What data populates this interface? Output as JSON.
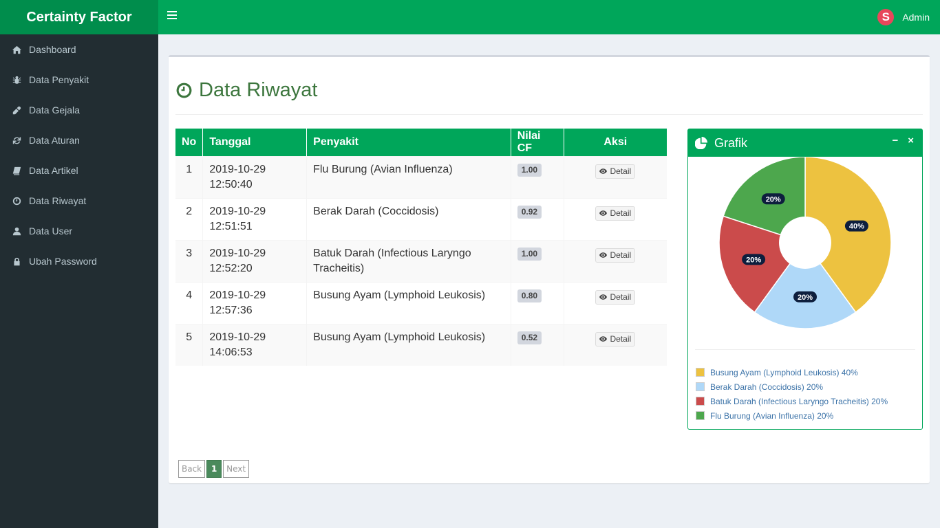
{
  "app": {
    "title": "Certainty Factor"
  },
  "header": {
    "user_name": "Admin",
    "avatar_letter": "S",
    "avatar_color": "#e8475b"
  },
  "sidebar": {
    "items": [
      {
        "label": "Dashboard",
        "icon": "home-icon"
      },
      {
        "label": "Data Penyakit",
        "icon": "bug-icon"
      },
      {
        "label": "Data Gejala",
        "icon": "eyedropper-icon"
      },
      {
        "label": "Data Aturan",
        "icon": "refresh-icon"
      },
      {
        "label": "Data Artikel",
        "icon": "book-icon"
      },
      {
        "label": "Data Riwayat",
        "icon": "clock-icon"
      },
      {
        "label": "Data User",
        "icon": "user-icon"
      },
      {
        "label": "Ubah Password",
        "icon": "lock-icon"
      }
    ]
  },
  "page": {
    "title": "Data Riwayat",
    "title_color": "#3c763d"
  },
  "table": {
    "headers": [
      "No",
      "Tanggal",
      "Penyakit",
      "Nilai CF",
      "Aksi"
    ],
    "rows": [
      {
        "no": "1",
        "date": "2019-10-29",
        "time": "12:50:40",
        "penyakit": "Flu Burung (Avian Influenza)",
        "cf": "1.00",
        "action": "Detail"
      },
      {
        "no": "2",
        "date": "2019-10-29",
        "time": "12:51:51",
        "penyakit": "Berak Darah (Coccidosis)",
        "cf": "0.92",
        "action": "Detail"
      },
      {
        "no": "3",
        "date": "2019-10-29",
        "time": "12:52:20",
        "penyakit": "Batuk Darah (Infectious Laryngo Tracheitis)",
        "cf": "1.00",
        "action": "Detail"
      },
      {
        "no": "4",
        "date": "2019-10-29",
        "time": "12:57:36",
        "penyakit": "Busung Ayam (Lymphoid Leukosis)",
        "cf": "0.80",
        "action": "Detail"
      },
      {
        "no": "5",
        "date": "2019-10-29",
        "time": "14:06:53",
        "penyakit": "Busung Ayam (Lymphoid Leukosis)",
        "cf": "0.52",
        "action": "Detail"
      }
    ]
  },
  "pagination": {
    "back": "Back",
    "current": "1",
    "next": "Next"
  },
  "panel": {
    "title": "Grafik",
    "minimize": "−",
    "close": "×"
  },
  "chart_data": {
    "type": "pie",
    "title": "Grafik",
    "donut": true,
    "categories": [
      "Busung Ayam (Lymphoid Leukosis)",
      "Berak Darah (Coccidosis)",
      "Batuk Darah (Infectious Laryngo Tracheitis)",
      "Flu Burung (Avian Influenza)"
    ],
    "values": [
      40,
      20,
      20,
      20
    ],
    "labels": [
      "40%",
      "20%",
      "20%",
      "20%"
    ],
    "legend_labels": [
      "Busung Ayam (Lymphoid Leukosis) 40%",
      "Berak Darah (Coccidosis) 20%",
      "Batuk Darah (Infectious Laryngo Tracheitis) 20%",
      "Flu Burung (Avian Influenza) 20%"
    ],
    "colors": [
      "#edc240",
      "#afd8f8",
      "#cb4b4b",
      "#4da74d"
    ],
    "legend_position": "bottom"
  }
}
